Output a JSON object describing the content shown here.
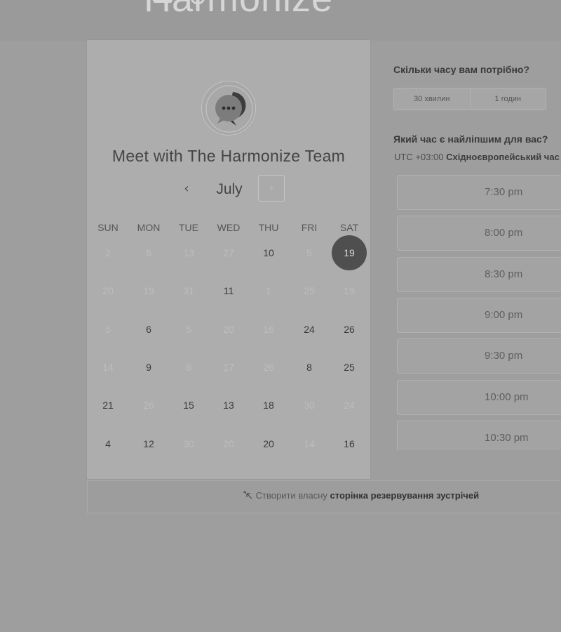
{
  "brand": {
    "name": "Harmonize",
    "icon": "harmonize-logo"
  },
  "calendar": {
    "title": "Meet with The Harmonize Team",
    "avatar_icon": "chat-bubble-icon",
    "month": "July",
    "prev_icon": "chevron-left-icon",
    "next_icon": "chevron-right-icon",
    "prev_symbol": "‹",
    "next_symbol": "›",
    "weekdays": [
      "SUN",
      "MON",
      "TUE",
      "WED",
      "THU",
      "FRI",
      "SAT"
    ],
    "weeks": [
      [
        {
          "d": "2",
          "s": "muted"
        },
        {
          "d": "6",
          "s": "muted"
        },
        {
          "d": "13",
          "s": "muted"
        },
        {
          "d": "27",
          "s": "muted"
        },
        {
          "d": "10",
          "s": "avail"
        },
        {
          "d": "5",
          "s": "muted"
        },
        {
          "d": "19",
          "s": "selected"
        }
      ],
      [
        {
          "d": "20",
          "s": "muted"
        },
        {
          "d": "19",
          "s": "muted"
        },
        {
          "d": "31",
          "s": "muted"
        },
        {
          "d": "11",
          "s": "avail"
        },
        {
          "d": "1",
          "s": "muted"
        },
        {
          "d": "25",
          "s": "muted"
        },
        {
          "d": "19",
          "s": "muted"
        }
      ],
      [
        {
          "d": "5",
          "s": "muted"
        },
        {
          "d": "6",
          "s": "avail"
        },
        {
          "d": "5",
          "s": "muted"
        },
        {
          "d": "20",
          "s": "muted"
        },
        {
          "d": "16",
          "s": "muted"
        },
        {
          "d": "24",
          "s": "avail"
        },
        {
          "d": "26",
          "s": "avail"
        }
      ],
      [
        {
          "d": "14",
          "s": "muted"
        },
        {
          "d": "9",
          "s": "avail"
        },
        {
          "d": "6",
          "s": "muted"
        },
        {
          "d": "17",
          "s": "muted"
        },
        {
          "d": "26",
          "s": "muted"
        },
        {
          "d": "8",
          "s": "avail"
        },
        {
          "d": "25",
          "s": "avail"
        }
      ],
      [
        {
          "d": "21",
          "s": "avail"
        },
        {
          "d": "26",
          "s": "muted"
        },
        {
          "d": "15",
          "s": "avail"
        },
        {
          "d": "13",
          "s": "avail"
        },
        {
          "d": "18",
          "s": "avail"
        },
        {
          "d": "30",
          "s": "muted"
        },
        {
          "d": "24",
          "s": "muted"
        }
      ],
      [
        {
          "d": "4",
          "s": "avail"
        },
        {
          "d": "12",
          "s": "avail"
        },
        {
          "d": "30",
          "s": "muted"
        },
        {
          "d": "20",
          "s": "muted"
        },
        {
          "d": "20",
          "s": "avail"
        },
        {
          "d": "14",
          "s": "muted"
        },
        {
          "d": "16",
          "s": "avail"
        }
      ]
    ]
  },
  "booking": {
    "duration_question": "Скільки часу вам потрібно?",
    "durations": [
      "30 хвилин",
      "1 годин"
    ],
    "time_question": "Який час є найліпшим для вас?",
    "timezone_offset": "UTC +03:00",
    "timezone_name": "Східноєвропейський час",
    "slots": [
      "7:30 pm",
      "8:00 pm",
      "8:30 pm",
      "9:00 pm",
      "9:30 pm",
      "10:00 pm",
      "10:30 pm"
    ]
  },
  "footer": {
    "icon": "sparkle-cursor-icon",
    "lead_text": "Створити власну",
    "bold_text": "сторінка резервування зустрічей"
  },
  "colors": {
    "selected_day": "#4f4f4f",
    "page_background": "#9e9e9e"
  }
}
